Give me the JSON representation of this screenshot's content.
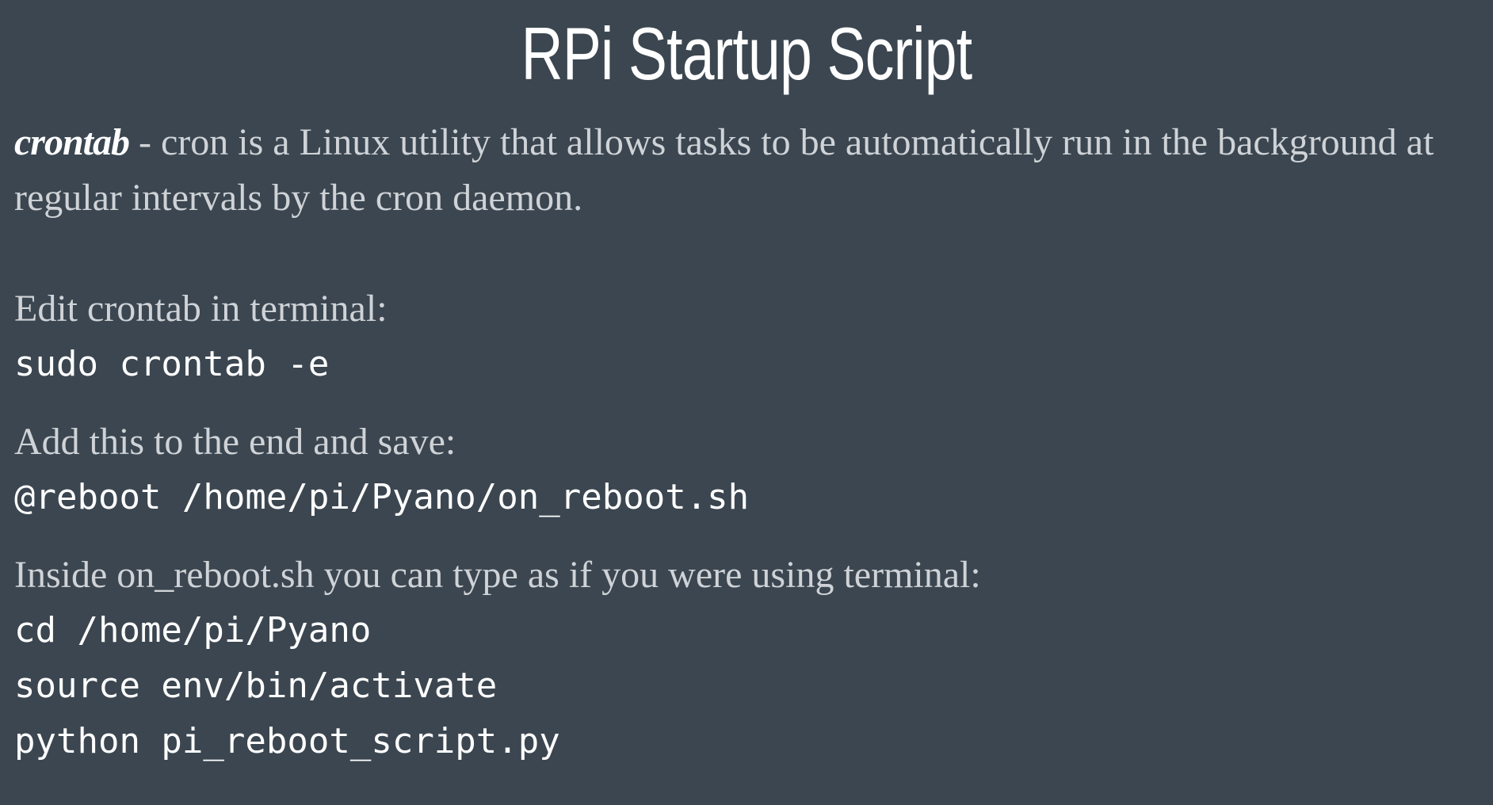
{
  "slide": {
    "title": "RPi Startup Script",
    "intro_term": "crontab",
    "intro_rest": " - cron is a Linux utility that allows tasks to be automatically run in the background at regular intervals by the cron daemon.",
    "step1_label": "Edit crontab in terminal:",
    "step1_code": "sudo crontab -e",
    "step2_label": "Add this to the end and save:",
    "step2_code": "@reboot /home/pi/Pyano/on_reboot.sh",
    "step3_label": "Inside on_reboot.sh you can type as if you were using terminal:",
    "step3_code_lines": [
      "cd /home/pi/Pyano",
      "source env/bin/activate",
      "python pi_reboot_script.py"
    ]
  },
  "colors": {
    "background": "#3b4650",
    "body_text": "#cfd3d7",
    "heading_text": "#ffffff"
  }
}
